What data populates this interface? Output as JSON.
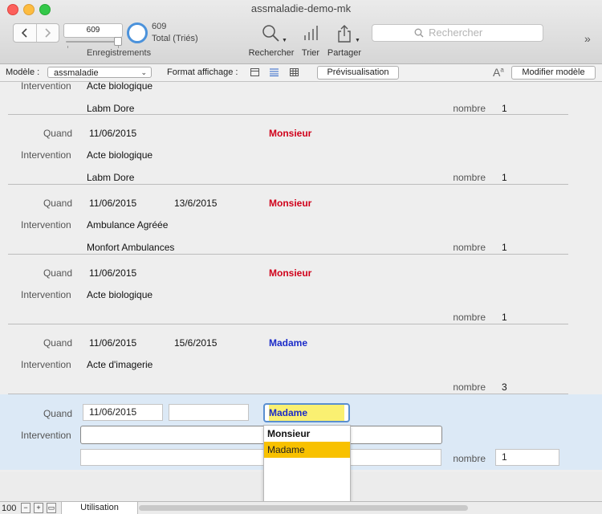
{
  "window": {
    "title": "assmaladie-demo-mk"
  },
  "toolbar": {
    "record_field": "609",
    "records_label": "Enregistrements",
    "count": "609",
    "count_label": "Total (Triés)",
    "search_label": "Rechercher",
    "sort_label": "Trier",
    "share_label": "Partager",
    "search_placeholder": "Rechercher",
    "overflow": "»"
  },
  "layoutbar": {
    "model_label": "Modèle :",
    "model_value": "assmaladie",
    "format_label": "Format affichage :",
    "preview_button": "Prévisualisation",
    "edit_model_button": "Modifier modèle"
  },
  "labels": {
    "quand": "Quand",
    "intervention": "Intervention",
    "nombre": "nombre"
  },
  "partial_record": {
    "intervention": "Acte biologique",
    "provider": "Labm Dore",
    "nombre": "1"
  },
  "records": [
    {
      "date1": "11/06/2015",
      "date2": "",
      "civilite": "Monsieur",
      "intervention": "Acte biologique",
      "provider": "Labm Dore",
      "nombre": "1"
    },
    {
      "date1": "11/06/2015",
      "date2": "13/6/2015",
      "civilite": "Monsieur",
      "intervention": "Ambulance Agréée",
      "provider": "Monfort Ambulances",
      "nombre": "1"
    },
    {
      "date1": "11/06/2015",
      "date2": "",
      "civilite": "Monsieur",
      "intervention": "Acte biologique",
      "provider": "",
      "nombre": "1"
    },
    {
      "date1": "11/06/2015",
      "date2": "15/6/2015",
      "civilite": "Madame",
      "intervention": "Acte d'imagerie",
      "provider": "",
      "nombre": "3"
    }
  ],
  "active_record": {
    "date1": "11/06/2015",
    "date2": "",
    "civilite": "Madame",
    "intervention": "",
    "provider": "",
    "nombre": "1"
  },
  "popup": {
    "options": [
      "Monsieur",
      "Madame"
    ],
    "selected": "Madame"
  },
  "statusbar": {
    "zoom": "100",
    "mode": "Utilisation"
  },
  "colors": {
    "monsieur": "#d0021b",
    "madame": "#1b2bc8",
    "highlight": "#f8c100"
  }
}
